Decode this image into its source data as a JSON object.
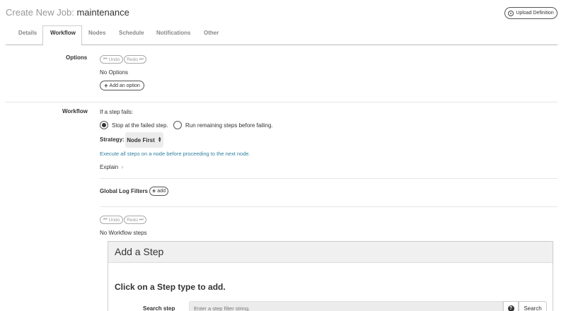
{
  "header": {
    "title_prefix": "Create New Job:",
    "job_name": "maintenance",
    "upload_label": "Upload Definition"
  },
  "tabs": [
    {
      "label": "Details"
    },
    {
      "label": "Workflow",
      "active": true
    },
    {
      "label": "Nodes"
    },
    {
      "label": "Schedule"
    },
    {
      "label": "Notifications"
    },
    {
      "label": "Other"
    }
  ],
  "options": {
    "label": "Options",
    "undo_label": "Undo",
    "redo_label": "Redo",
    "empty_text": "No Options",
    "add_label": "Add an option"
  },
  "workflow": {
    "label": "Workflow",
    "if_fails_text": "If a step fails:",
    "radio_stop": "Stop at the failed step.",
    "radio_run": "Run remaining steps before failing.",
    "strategy_label": "Strategy:",
    "strategy_value": "Node First",
    "strategy_description": "Execute all steps on a node before proceeding to the next node.",
    "explain_label": "Explain",
    "global_log_filters_label": "Global Log Filters",
    "add_filter_label": "add",
    "undo_label": "Undo",
    "redo_label": "Redo",
    "empty_steps_text": "No Workflow steps"
  },
  "add_step": {
    "title": "Add a Step",
    "subtitle": "Click on a Step type to add.",
    "search_label": "Search step",
    "search_placeholder": "Enter a step filter string.",
    "search_button": "Search"
  },
  "colors": {
    "link": "#2f7fa0",
    "muted": "#999999",
    "panel_header": "#f0f0f0"
  }
}
